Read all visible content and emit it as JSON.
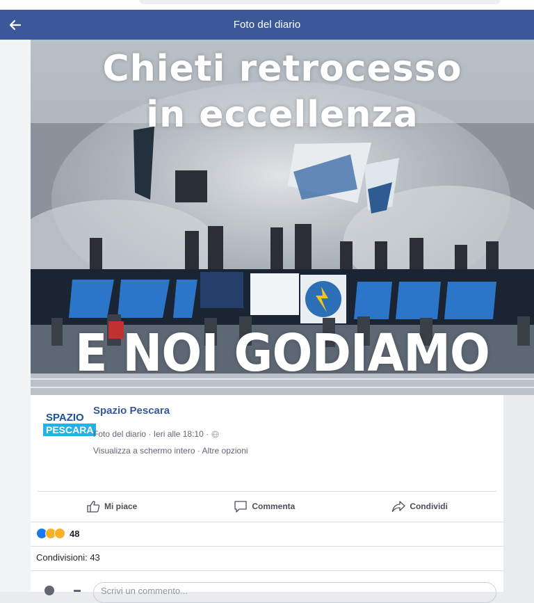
{
  "header": {
    "title": "Foto del diario"
  },
  "photo": {
    "line1": "Chieti retrocesso",
    "line2": "in eccellenza",
    "line3": "E NOI GODIAMO"
  },
  "post": {
    "logo_line1": "SPAZIO",
    "logo_line2": "PESCARA",
    "page_name": "Spazio Pescara",
    "meta_text": "Foto del diario · Ieri alle 18:10 ·",
    "link_fullscreen": "Visualizza a schermo intero",
    "link_sep": " · ",
    "link_options": "Altre opzioni"
  },
  "actions": {
    "like": "Mi piace",
    "comment": "Commenta",
    "share": "Condividi"
  },
  "reactions": {
    "count": "48",
    "colors": [
      "#1877f2",
      "#f7b125",
      "#f7b125"
    ]
  },
  "shares": "Condivisioni: 43",
  "comment_placeholder": "Scrivi un commento..."
}
